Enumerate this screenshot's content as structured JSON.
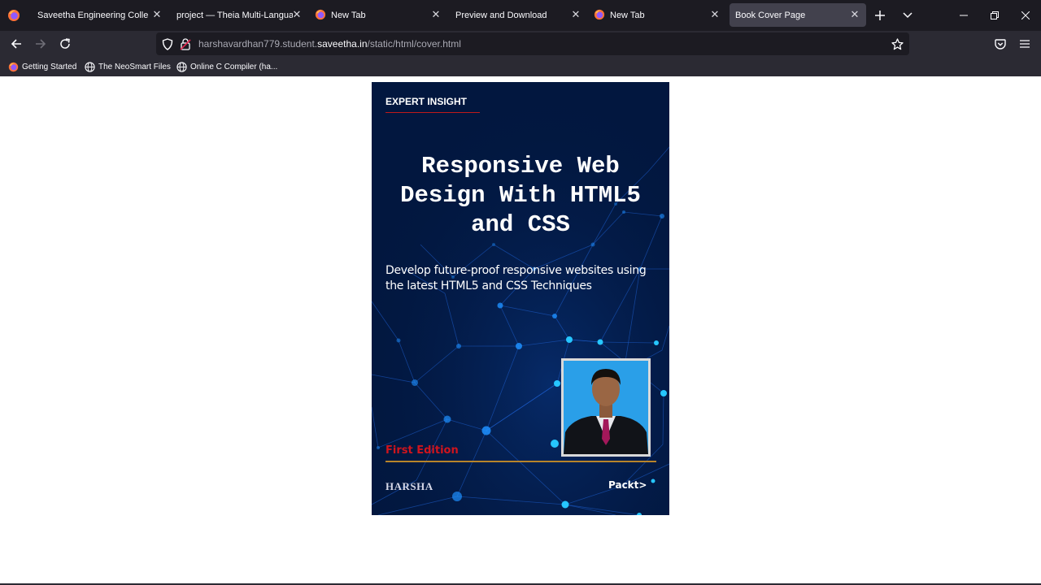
{
  "tabs": [
    {
      "label": "Saveetha Engineering College",
      "icon": "none",
      "active": false
    },
    {
      "label": "project — Theia Multi-Language",
      "icon": "none",
      "active": false
    },
    {
      "label": "New Tab",
      "icon": "firefox-icon",
      "active": false
    },
    {
      "label": "Preview and Download",
      "icon": "none",
      "active": false
    },
    {
      "label": "New Tab",
      "icon": "firefox-icon",
      "active": false
    },
    {
      "label": "Book Cover Page",
      "icon": "none",
      "active": true
    }
  ],
  "address": {
    "prefix": "harshavardhan779.student.",
    "host": "saveetha.in",
    "path": "/static/html/cover.html"
  },
  "bookmarks": [
    {
      "label": "Getting Started",
      "icon": "firefox-icon"
    },
    {
      "label": "The NeoSmart Files",
      "icon": "globe-icon"
    },
    {
      "label": "Online C Compiler (ha...",
      "icon": "globe-icon"
    }
  ],
  "cover": {
    "series": "EXPERT INSIGHT",
    "title_lines": [
      "Responsive Web",
      "Design With HTML5",
      "and CSS"
    ],
    "subtitle": "Develop future-proof responsive websites using the latest HTML5 and CSS Techniques",
    "edition": "First Edition",
    "author": "HARSHA",
    "publisher": "Packt>"
  },
  "colors": {
    "cover_background": "#02173f",
    "accent_red": "#d0141d",
    "edition_rule": "#b8842a",
    "network_node": "#1e90ff"
  }
}
